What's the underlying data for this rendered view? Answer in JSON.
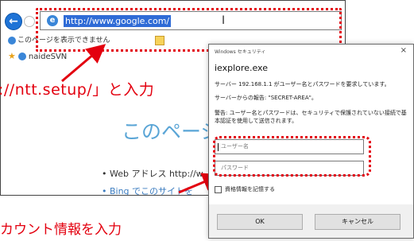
{
  "browser": {
    "back_glyph": "←",
    "url": "http://www.google.com/",
    "tab_label": "このページを表示できません",
    "favorite_label": "naideSVN",
    "page_heading": "このページを表",
    "bullet1": "• Web アドレス http://w",
    "bullet2": "• Bing でこのサイトを"
  },
  "annotations": {
    "enter_url_text": "://ntt.setup/」と入力",
    "enter_account_text": "カウント情報を入力",
    "accent_color": "#e3000f"
  },
  "dialog": {
    "header": "Windows セキュリティ",
    "close_glyph": "×",
    "title": "iexplore.exe",
    "message1": "サーバー 192.168.1.1 がユーザー名とパスワードを要求しています。",
    "message2": "サーバーからの報告: \"SECRET-AREA\"。",
    "warning_line1": "警告: ユーザー名とパスワードは、セキュリティで保護されていない接続で基",
    "warning_line2": "本認証を使用して送信されます。",
    "username_placeholder": "ユーザー名",
    "password_placeholder": "パスワード",
    "remember_label": "資格情報を記憶する",
    "ok_label": "OK",
    "cancel_label": "キャンセル"
  }
}
